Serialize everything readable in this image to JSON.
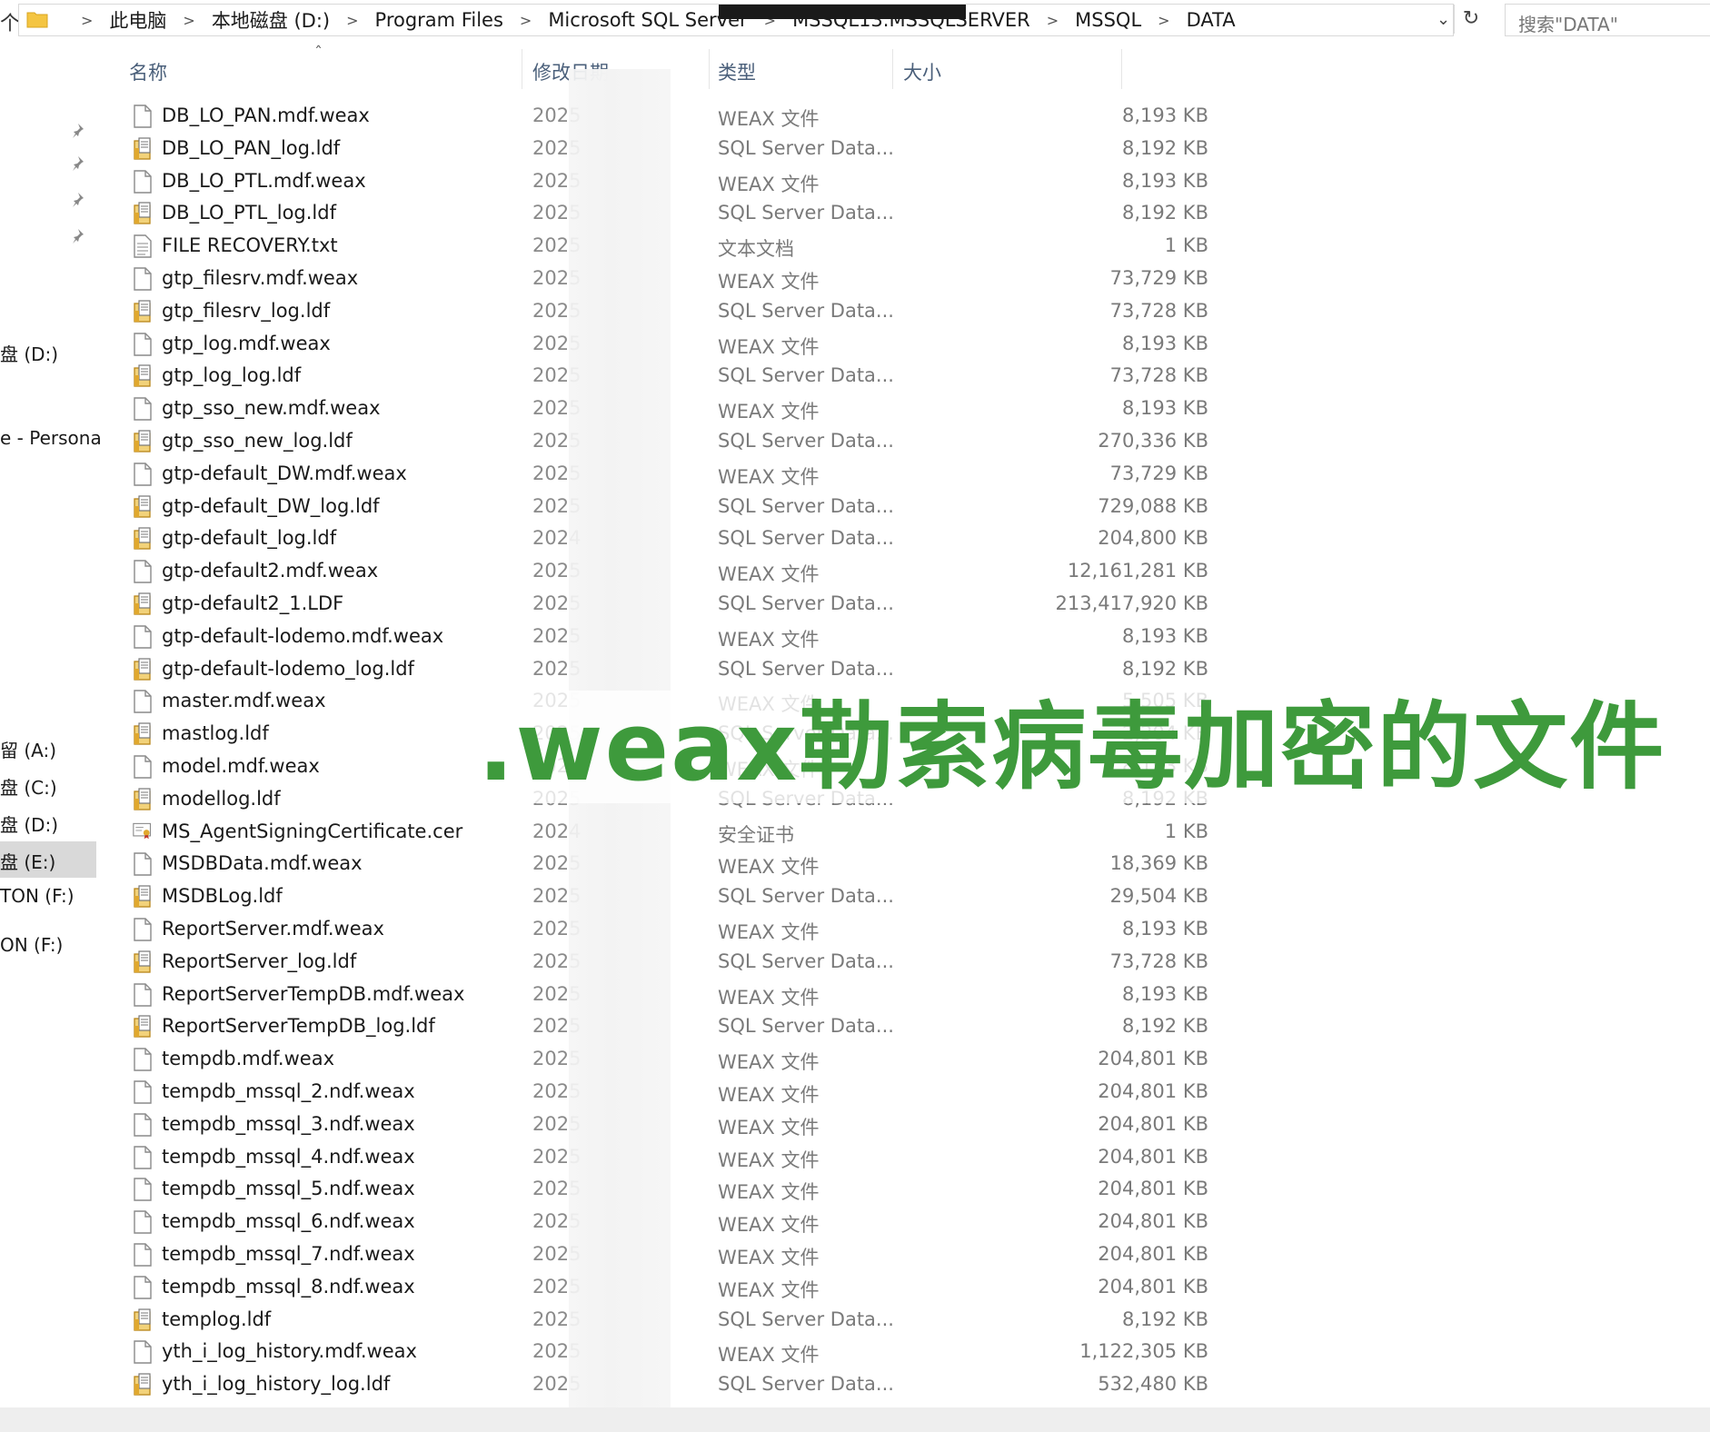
{
  "address": {
    "up_glyph": "个",
    "crumbs": [
      "此电脑",
      "本地磁盘 (D:)",
      "Program Files",
      "Microsoft SQL Server",
      "MSSQL13.MSSQLSERVER",
      "MSSQL",
      "DATA"
    ],
    "search_placeholder": "搜索\"DATA\""
  },
  "nav": {
    "items": [
      {
        "label": "盘 (D:)"
      },
      {
        "label": "e - Persona"
      },
      {
        "label": "留 (A:)"
      },
      {
        "label": "盘 (C:)"
      },
      {
        "label": "盘 (D:)"
      },
      {
        "label": "盘 (E:)"
      },
      {
        "label": "TON (F:)"
      },
      {
        "label": "ON (F:)"
      }
    ]
  },
  "columns": {
    "name": "名称",
    "date": "修改日期",
    "type": "类型",
    "size": "大小"
  },
  "files": [
    {
      "name": "DB_LO_PAN.mdf.weax",
      "date": "2025",
      "type": "WEAX 文件",
      "size": "8,193 KB",
      "icon": "file-icon"
    },
    {
      "name": "DB_LO_PAN_log.ldf",
      "date": "2025",
      "type": "SQL Server Data...",
      "size": "8,192 KB",
      "icon": "sql-data-icon"
    },
    {
      "name": "DB_LO_PTL.mdf.weax",
      "date": "2025",
      "type": "WEAX 文件",
      "size": "8,193 KB",
      "icon": "file-icon"
    },
    {
      "name": "DB_LO_PTL_log.ldf",
      "date": "2025",
      "type": "SQL Server Data...",
      "size": "8,192 KB",
      "icon": "sql-data-icon"
    },
    {
      "name": "FILE RECOVERY.txt",
      "date": "2025",
      "type": "文本文档",
      "size": "1 KB",
      "icon": "text-file-icon"
    },
    {
      "name": "gtp_filesrv.mdf.weax",
      "date": "2025",
      "type": "WEAX 文件",
      "size": "73,729 KB",
      "icon": "file-icon"
    },
    {
      "name": "gtp_filesrv_log.ldf",
      "date": "2025",
      "type": "SQL Server Data...",
      "size": "73,728 KB",
      "icon": "sql-data-icon"
    },
    {
      "name": "gtp_log.mdf.weax",
      "date": "2025",
      "type": "WEAX 文件",
      "size": "8,193 KB",
      "icon": "file-icon"
    },
    {
      "name": "gtp_log_log.ldf",
      "date": "2025",
      "type": "SQL Server Data...",
      "size": "73,728 KB",
      "icon": "sql-data-icon"
    },
    {
      "name": "gtp_sso_new.mdf.weax",
      "date": "2025",
      "type": "WEAX 文件",
      "size": "8,193 KB",
      "icon": "file-icon"
    },
    {
      "name": "gtp_sso_new_log.ldf",
      "date": "2025",
      "type": "SQL Server Data...",
      "size": "270,336 KB",
      "icon": "sql-data-icon"
    },
    {
      "name": "gtp-default_DW.mdf.weax",
      "date": "2025",
      "type": "WEAX 文件",
      "size": "73,729 KB",
      "icon": "file-icon"
    },
    {
      "name": "gtp-default_DW_log.ldf",
      "date": "2025",
      "type": "SQL Server Data...",
      "size": "729,088 KB",
      "icon": "sql-data-icon"
    },
    {
      "name": "gtp-default_log.ldf",
      "date": "2024",
      "type": "SQL Server Data...",
      "size": "204,800 KB",
      "icon": "sql-data-icon"
    },
    {
      "name": "gtp-default2.mdf.weax",
      "date": "2025",
      "type": "WEAX 文件",
      "size": "12,161,281 KB",
      "icon": "file-icon"
    },
    {
      "name": "gtp-default2_1.LDF",
      "date": "2025",
      "type": "SQL Server Data...",
      "size": "213,417,920 KB",
      "icon": "sql-data-icon"
    },
    {
      "name": "gtp-default-lodemo.mdf.weax",
      "date": "2025",
      "type": "WEAX 文件",
      "size": "8,193 KB",
      "icon": "file-icon"
    },
    {
      "name": "gtp-default-lodemo_log.ldf",
      "date": "2025",
      "type": "SQL Server Data...",
      "size": "8,192 KB",
      "icon": "sql-data-icon"
    },
    {
      "name": "master.mdf.weax",
      "date": "2025",
      "type": "WEAX 文件",
      "size": "5,505 KB",
      "icon": "file-icon"
    },
    {
      "name": "mastlog.ldf",
      "date": "2025",
      "type": "SQL Server Data...",
      "size": "2,304 KB",
      "icon": "sql-data-icon"
    },
    {
      "name": "model.mdf.weax",
      "date": "2025",
      "type": "WEAX 文件",
      "size": "8,193 KB",
      "icon": "file-icon"
    },
    {
      "name": "modellog.ldf",
      "date": "2025",
      "type": "SQL Server Data...",
      "size": "8,192 KB",
      "icon": "sql-data-icon"
    },
    {
      "name": "MS_AgentSigningCertificate.cer",
      "date": "2024",
      "type": "安全证书",
      "size": "1 KB",
      "icon": "certificate-icon"
    },
    {
      "name": "MSDBData.mdf.weax",
      "date": "2025",
      "type": "WEAX 文件",
      "size": "18,369 KB",
      "icon": "file-icon"
    },
    {
      "name": "MSDBLog.ldf",
      "date": "2025",
      "type": "SQL Server Data...",
      "size": "29,504 KB",
      "icon": "sql-data-icon"
    },
    {
      "name": "ReportServer.mdf.weax",
      "date": "2025",
      "type": "WEAX 文件",
      "size": "8,193 KB",
      "icon": "file-icon"
    },
    {
      "name": "ReportServer_log.ldf",
      "date": "2025",
      "type": "SQL Server Data...",
      "size": "73,728 KB",
      "icon": "sql-data-icon"
    },
    {
      "name": "ReportServerTempDB.mdf.weax",
      "date": "2025",
      "type": "WEAX 文件",
      "size": "8,193 KB",
      "icon": "file-icon"
    },
    {
      "name": "ReportServerTempDB_log.ldf",
      "date": "2025",
      "type": "SQL Server Data...",
      "size": "8,192 KB",
      "icon": "sql-data-icon"
    },
    {
      "name": "tempdb.mdf.weax",
      "date": "2025",
      "type": "WEAX 文件",
      "size": "204,801 KB",
      "icon": "file-icon"
    },
    {
      "name": "tempdb_mssql_2.ndf.weax",
      "date": "2025",
      "type": "WEAX 文件",
      "size": "204,801 KB",
      "icon": "file-icon"
    },
    {
      "name": "tempdb_mssql_3.ndf.weax",
      "date": "2025",
      "type": "WEAX 文件",
      "size": "204,801 KB",
      "icon": "file-icon"
    },
    {
      "name": "tempdb_mssql_4.ndf.weax",
      "date": "2025",
      "type": "WEAX 文件",
      "size": "204,801 KB",
      "icon": "file-icon"
    },
    {
      "name": "tempdb_mssql_5.ndf.weax",
      "date": "2025",
      "type": "WEAX 文件",
      "size": "204,801 KB",
      "icon": "file-icon"
    },
    {
      "name": "tempdb_mssql_6.ndf.weax",
      "date": "2025",
      "type": "WEAX 文件",
      "size": "204,801 KB",
      "icon": "file-icon"
    },
    {
      "name": "tempdb_mssql_7.ndf.weax",
      "date": "2025",
      "type": "WEAX 文件",
      "size": "204,801 KB",
      "icon": "file-icon"
    },
    {
      "name": "tempdb_mssql_8.ndf.weax",
      "date": "2025",
      "type": "WEAX 文件",
      "size": "204,801 KB",
      "icon": "file-icon"
    },
    {
      "name": "templog.ldf",
      "date": "2025",
      "type": "SQL Server Data...",
      "size": "8,192 KB",
      "icon": "sql-data-icon"
    },
    {
      "name": "yth_i_log_history.mdf.weax",
      "date": "2025",
      "type": "WEAX 文件",
      "size": "1,122,305 KB",
      "icon": "file-icon"
    },
    {
      "name": "yth_i_log_history_log.ldf",
      "date": "2025",
      "type": "SQL Server Data...",
      "size": "532,480 KB",
      "icon": "sql-data-icon"
    }
  ],
  "overlay_caption": ".weax勒索病毒加密的文件",
  "colors": {
    "caption": "#3e9a3c",
    "header_text": "#4a5f7a",
    "selected_nav": "#d9d9d9",
    "folder": "#f4c542",
    "sql_icon": "#e0a82e"
  }
}
